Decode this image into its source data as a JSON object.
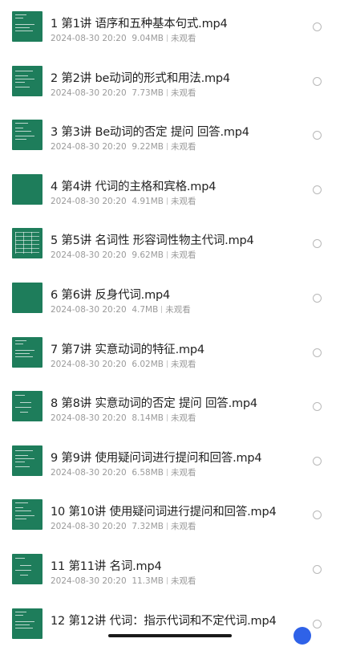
{
  "files": [
    {
      "title": "1 第1讲 语序和五种基本句式.mp4",
      "date": "2024-08-30 20:20",
      "size": "9.04MB",
      "status": "未观看",
      "thumb": "lines-a"
    },
    {
      "title": "2 第2讲 be动词的形式和用法.mp4",
      "date": "2024-08-30 20:20",
      "size": "7.73MB",
      "status": "未观看",
      "thumb": "lines-b"
    },
    {
      "title": "3 第3讲 Be动词的否定 提问 回答.mp4",
      "date": "2024-08-30 20:20",
      "size": "9.22MB",
      "status": "未观看",
      "thumb": "lines-c"
    },
    {
      "title": "4 第4讲 代词的主格和宾格.mp4",
      "date": "2024-08-30 20:20",
      "size": "4.91MB",
      "status": "未观看",
      "thumb": "plain"
    },
    {
      "title": "5 第5讲 名词性 形容词性物主代词.mp4",
      "date": "2024-08-30 20:20",
      "size": "9.62MB",
      "status": "未观看",
      "thumb": "grid"
    },
    {
      "title": "6 第6讲 反身代词.mp4",
      "date": "2024-08-30 20:20",
      "size": "4.7MB",
      "status": "未观看",
      "thumb": "plain"
    },
    {
      "title": "7 第7讲 实意动词的特征.mp4",
      "date": "2024-08-30 20:20",
      "size": "6.02MB",
      "status": "未观看",
      "thumb": "lines-a"
    },
    {
      "title": "8 第8讲 实意动词的否定 提问 回答.mp4",
      "date": "2024-08-30 20:20",
      "size": "8.14MB",
      "status": "未观看",
      "thumb": "lines-d"
    },
    {
      "title": "9 第9讲 使用疑问词进行提问和回答.mp4",
      "date": "2024-08-30 20:20",
      "size": "6.58MB",
      "status": "未观看",
      "thumb": "lines-b"
    },
    {
      "title": "10 第10讲 使用疑问词进行提问和回答.mp4",
      "date": "2024-08-30 20:20",
      "size": "7.32MB",
      "status": "未观看",
      "thumb": "lines-c"
    },
    {
      "title": "11 第11讲 名词.mp4",
      "date": "2024-08-30 20:20",
      "size": "11.3MB",
      "status": "未观看",
      "thumb": "lines-d"
    },
    {
      "title": "12 第12讲 代词：指示代词和不定代词.mp4",
      "date": "",
      "size": "",
      "status": "",
      "thumb": "lines-a"
    }
  ],
  "colors": {
    "thumb_bg": "#1e7d5b",
    "title_text": "#222222",
    "meta_text": "#9a9a9a",
    "radio_border": "#b8b8b8",
    "fab": "#2f62e8"
  },
  "icons": {
    "thumbnail": "video-thumbnail-icon",
    "select": "radio-circle-icon"
  }
}
